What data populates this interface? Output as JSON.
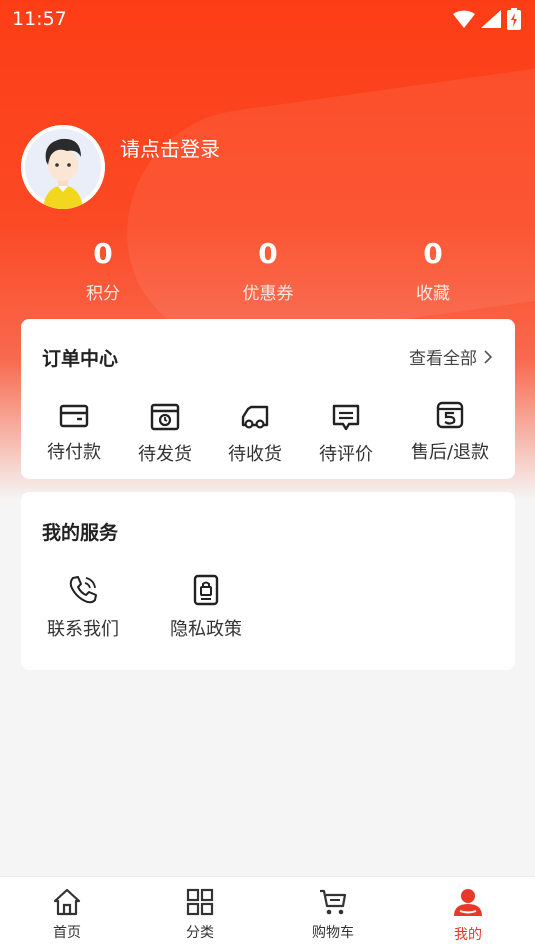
{
  "status_bar": {
    "time": "11:57"
  },
  "profile": {
    "login_prompt": "请点击登录"
  },
  "stats": [
    {
      "value": "0",
      "label": "积分"
    },
    {
      "value": "0",
      "label": "优惠券"
    },
    {
      "value": "0",
      "label": "收藏"
    }
  ],
  "orders": {
    "title": "订单中心",
    "view_all": "查看全部",
    "items": [
      {
        "label": "待付款",
        "icon": "wallet-icon"
      },
      {
        "label": "待发货",
        "icon": "box-icon"
      },
      {
        "label": "待收货",
        "icon": "truck-icon"
      },
      {
        "label": "待评价",
        "icon": "comment-icon"
      },
      {
        "label": "售后/退款",
        "icon": "refund-icon"
      }
    ]
  },
  "services": {
    "title": "我的服务",
    "items": [
      {
        "label": "联系我们",
        "icon": "phone-icon"
      },
      {
        "label": "隐私政策",
        "icon": "lock-doc-icon"
      }
    ]
  },
  "tabbar": {
    "items": [
      {
        "label": "首页",
        "icon": "home-icon"
      },
      {
        "label": "分类",
        "icon": "grid-icon"
      },
      {
        "label": "购物车",
        "icon": "cart-icon"
      },
      {
        "label": "我的",
        "icon": "user-icon",
        "active": true
      }
    ],
    "active_color": "#e8382a"
  },
  "colors": {
    "brand": "#fd3d16",
    "background": "#f5f5f5"
  }
}
